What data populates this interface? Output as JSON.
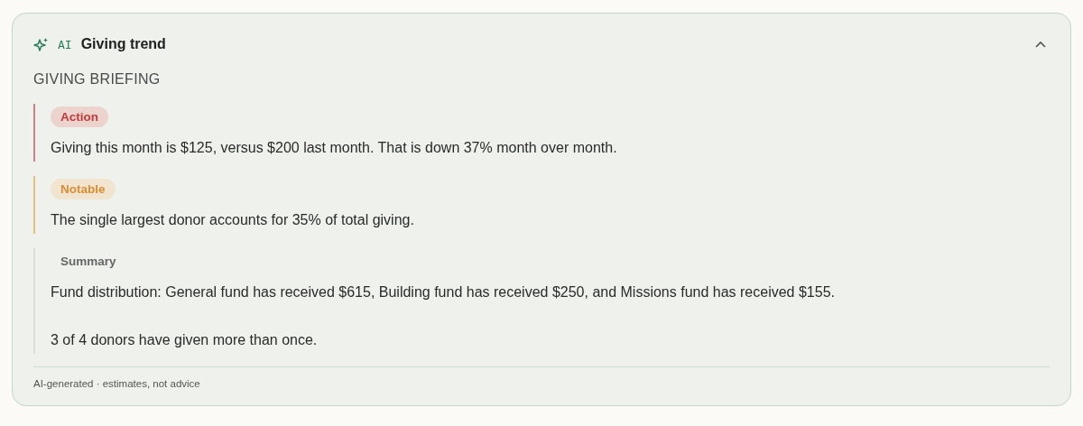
{
  "card": {
    "badge": "AI",
    "title": "Giving trend",
    "expanded": true
  },
  "section_title": "GIVING BRIEFING",
  "insights": [
    {
      "kind": "action",
      "tag": "Action",
      "paragraphs": [
        "Giving this month is $125, versus $200 last month. That is down 37% month over month."
      ]
    },
    {
      "kind": "notable",
      "tag": "Notable",
      "paragraphs": [
        "The single largest donor accounts for 35% of total giving."
      ]
    },
    {
      "kind": "summary",
      "tag": "Summary",
      "paragraphs": [
        "Fund distribution: General fund has received $615, Building fund has received $250, and Missions fund has received $155.",
        "3 of 4 donors have given more than once."
      ]
    }
  ],
  "footer": "AI-generated · estimates, not advice"
}
